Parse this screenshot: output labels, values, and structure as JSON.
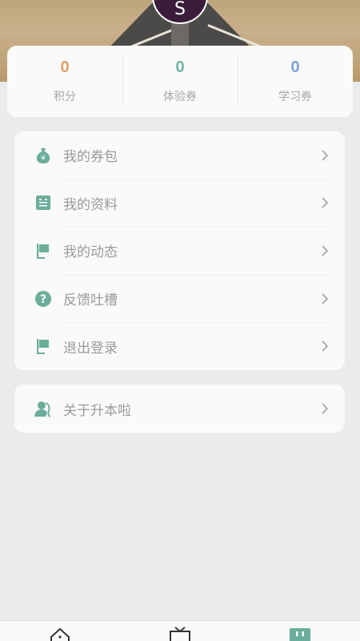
{
  "profile": {
    "avatar_initial": "S"
  },
  "stats": [
    {
      "value": "0",
      "label": "积分",
      "color": "#e0a06a"
    },
    {
      "value": "0",
      "label": "体验券",
      "color": "#6fb3a3"
    },
    {
      "value": "0",
      "label": "学习券",
      "color": "#7ca0d8"
    }
  ],
  "menu": {
    "items": [
      {
        "label": "我的券包",
        "icon": "money-bag-icon"
      },
      {
        "label": "我的资料",
        "icon": "document-icon"
      },
      {
        "label": "我的动态",
        "icon": "flag-icon"
      },
      {
        "label": "反馈吐槽",
        "icon": "question-icon"
      },
      {
        "label": "退出登录",
        "icon": "flag-icon"
      }
    ]
  },
  "about": {
    "label": "关于升本啦",
    "icon": "user-icon"
  },
  "colors": {
    "accent": "#6aae9b",
    "text_muted": "#9b9b9b"
  },
  "tabbar": {
    "tabs": [
      {
        "icon": "home-icon"
      },
      {
        "icon": "tv-icon"
      },
      {
        "icon": "profile-tab-icon",
        "active": true
      }
    ]
  }
}
